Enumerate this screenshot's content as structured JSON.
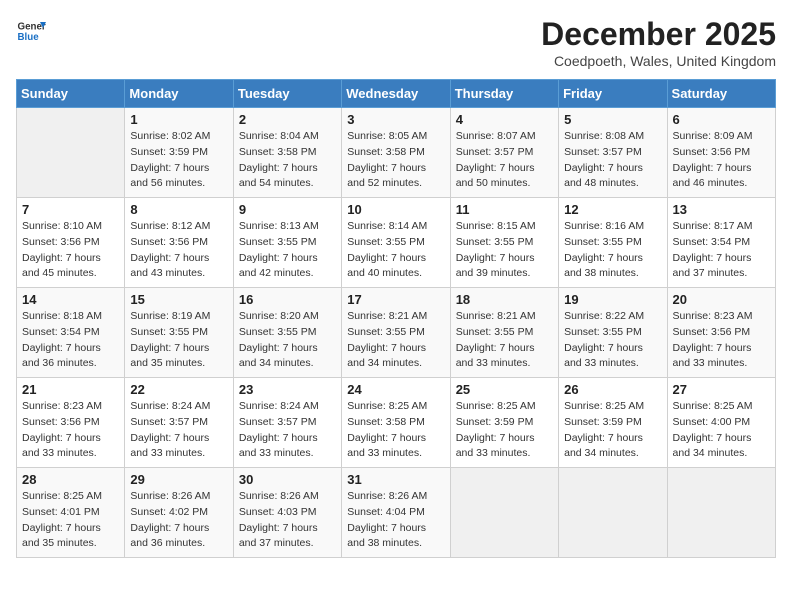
{
  "header": {
    "logo_line1": "General",
    "logo_line2": "Blue",
    "month_title": "December 2025",
    "subtitle": "Coedpoeth, Wales, United Kingdom"
  },
  "days_of_week": [
    "Sunday",
    "Monday",
    "Tuesday",
    "Wednesday",
    "Thursday",
    "Friday",
    "Saturday"
  ],
  "weeks": [
    [
      {
        "day": "",
        "info": ""
      },
      {
        "day": "1",
        "info": "Sunrise: 8:02 AM\nSunset: 3:59 PM\nDaylight: 7 hours\nand 56 minutes."
      },
      {
        "day": "2",
        "info": "Sunrise: 8:04 AM\nSunset: 3:58 PM\nDaylight: 7 hours\nand 54 minutes."
      },
      {
        "day": "3",
        "info": "Sunrise: 8:05 AM\nSunset: 3:58 PM\nDaylight: 7 hours\nand 52 minutes."
      },
      {
        "day": "4",
        "info": "Sunrise: 8:07 AM\nSunset: 3:57 PM\nDaylight: 7 hours\nand 50 minutes."
      },
      {
        "day": "5",
        "info": "Sunrise: 8:08 AM\nSunset: 3:57 PM\nDaylight: 7 hours\nand 48 minutes."
      },
      {
        "day": "6",
        "info": "Sunrise: 8:09 AM\nSunset: 3:56 PM\nDaylight: 7 hours\nand 46 minutes."
      }
    ],
    [
      {
        "day": "7",
        "info": "Sunrise: 8:10 AM\nSunset: 3:56 PM\nDaylight: 7 hours\nand 45 minutes."
      },
      {
        "day": "8",
        "info": "Sunrise: 8:12 AM\nSunset: 3:56 PM\nDaylight: 7 hours\nand 43 minutes."
      },
      {
        "day": "9",
        "info": "Sunrise: 8:13 AM\nSunset: 3:55 PM\nDaylight: 7 hours\nand 42 minutes."
      },
      {
        "day": "10",
        "info": "Sunrise: 8:14 AM\nSunset: 3:55 PM\nDaylight: 7 hours\nand 40 minutes."
      },
      {
        "day": "11",
        "info": "Sunrise: 8:15 AM\nSunset: 3:55 PM\nDaylight: 7 hours\nand 39 minutes."
      },
      {
        "day": "12",
        "info": "Sunrise: 8:16 AM\nSunset: 3:55 PM\nDaylight: 7 hours\nand 38 minutes."
      },
      {
        "day": "13",
        "info": "Sunrise: 8:17 AM\nSunset: 3:54 PM\nDaylight: 7 hours\nand 37 minutes."
      }
    ],
    [
      {
        "day": "14",
        "info": "Sunrise: 8:18 AM\nSunset: 3:54 PM\nDaylight: 7 hours\nand 36 minutes."
      },
      {
        "day": "15",
        "info": "Sunrise: 8:19 AM\nSunset: 3:55 PM\nDaylight: 7 hours\nand 35 minutes."
      },
      {
        "day": "16",
        "info": "Sunrise: 8:20 AM\nSunset: 3:55 PM\nDaylight: 7 hours\nand 34 minutes."
      },
      {
        "day": "17",
        "info": "Sunrise: 8:21 AM\nSunset: 3:55 PM\nDaylight: 7 hours\nand 34 minutes."
      },
      {
        "day": "18",
        "info": "Sunrise: 8:21 AM\nSunset: 3:55 PM\nDaylight: 7 hours\nand 33 minutes."
      },
      {
        "day": "19",
        "info": "Sunrise: 8:22 AM\nSunset: 3:55 PM\nDaylight: 7 hours\nand 33 minutes."
      },
      {
        "day": "20",
        "info": "Sunrise: 8:23 AM\nSunset: 3:56 PM\nDaylight: 7 hours\nand 33 minutes."
      }
    ],
    [
      {
        "day": "21",
        "info": "Sunrise: 8:23 AM\nSunset: 3:56 PM\nDaylight: 7 hours\nand 33 minutes."
      },
      {
        "day": "22",
        "info": "Sunrise: 8:24 AM\nSunset: 3:57 PM\nDaylight: 7 hours\nand 33 minutes."
      },
      {
        "day": "23",
        "info": "Sunrise: 8:24 AM\nSunset: 3:57 PM\nDaylight: 7 hours\nand 33 minutes."
      },
      {
        "day": "24",
        "info": "Sunrise: 8:25 AM\nSunset: 3:58 PM\nDaylight: 7 hours\nand 33 minutes."
      },
      {
        "day": "25",
        "info": "Sunrise: 8:25 AM\nSunset: 3:59 PM\nDaylight: 7 hours\nand 33 minutes."
      },
      {
        "day": "26",
        "info": "Sunrise: 8:25 AM\nSunset: 3:59 PM\nDaylight: 7 hours\nand 34 minutes."
      },
      {
        "day": "27",
        "info": "Sunrise: 8:25 AM\nSunset: 4:00 PM\nDaylight: 7 hours\nand 34 minutes."
      }
    ],
    [
      {
        "day": "28",
        "info": "Sunrise: 8:25 AM\nSunset: 4:01 PM\nDaylight: 7 hours\nand 35 minutes."
      },
      {
        "day": "29",
        "info": "Sunrise: 8:26 AM\nSunset: 4:02 PM\nDaylight: 7 hours\nand 36 minutes."
      },
      {
        "day": "30",
        "info": "Sunrise: 8:26 AM\nSunset: 4:03 PM\nDaylight: 7 hours\nand 37 minutes."
      },
      {
        "day": "31",
        "info": "Sunrise: 8:26 AM\nSunset: 4:04 PM\nDaylight: 7 hours\nand 38 minutes."
      },
      {
        "day": "",
        "info": ""
      },
      {
        "day": "",
        "info": ""
      },
      {
        "day": "",
        "info": ""
      }
    ]
  ]
}
